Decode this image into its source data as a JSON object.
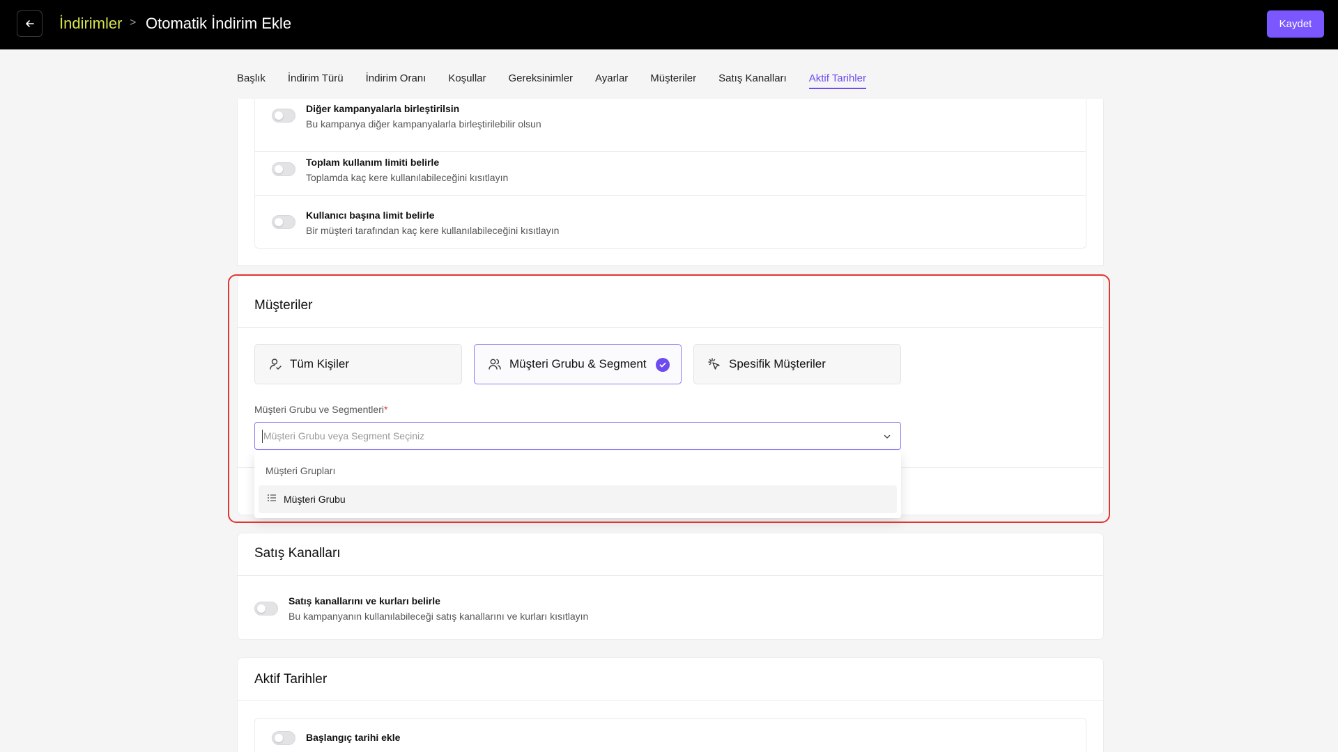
{
  "header": {
    "breadcrumb_root": "İndirimler",
    "breadcrumb_separator": ">",
    "breadcrumb_current": "Otomatik İndirim Ekle",
    "save_label": "Kaydet",
    "accent_color": "#7b57ff",
    "breadcrumb_root_color": "#d6e24a"
  },
  "tabs": [
    {
      "label": "Başlık"
    },
    {
      "label": "İndirim Türü"
    },
    {
      "label": "İndirim Oranı"
    },
    {
      "label": "Koşullar"
    },
    {
      "label": "Gereksinimler"
    },
    {
      "label": "Ayarlar"
    },
    {
      "label": "Müşteriler"
    },
    {
      "label": "Satış Kanalları"
    },
    {
      "label": "Aktif Tarihler",
      "active": true
    }
  ],
  "settings": {
    "options": [
      {
        "title": "Diğer kampanyalarla birleştirilsin",
        "desc": "Bu kampanya diğer kampanyalarla birleştirilebilir olsun",
        "enabled": false
      },
      {
        "title": "Toplam kullanım limiti belirle",
        "desc": "Toplamda kaç kere kullanılabileceğini kısıtlayın",
        "enabled": false
      },
      {
        "title": "Kullanıcı başına limit belirle",
        "desc": "Bir müşteri tarafından kaç kere kullanılabileceğini kısıtlayın",
        "enabled": false
      }
    ]
  },
  "customers": {
    "title": "Müşteriler",
    "choices": [
      {
        "label": "Tüm Kişiler",
        "icon": "user-check-icon",
        "selected": false
      },
      {
        "label": "Müşteri Grubu & Segment",
        "icon": "users-icon",
        "selected": true
      },
      {
        "label": "Spesifik Müşteriler",
        "icon": "pointer-click-icon",
        "selected": false
      }
    ],
    "field_label": "Müşteri Grubu ve Segmentleri",
    "required_mark": "*",
    "select_placeholder": "Müşteri Grubu veya Segment Seçiniz",
    "dropdown_group": "Müşteri Grupları",
    "dropdown_item": "Müşteri Grubu"
  },
  "sales_channels": {
    "title": "Satış Kanalları",
    "option_title": "Satış kanallarını ve kurları belirle",
    "option_desc": "Bu kampanyanın kullanılabileceği satış kanallarını ve kurları kısıtlayın",
    "enabled": false
  },
  "active_dates": {
    "title": "Aktif Tarihler",
    "option_title": "Başlangıç tarihi ekle",
    "enabled": false
  }
}
